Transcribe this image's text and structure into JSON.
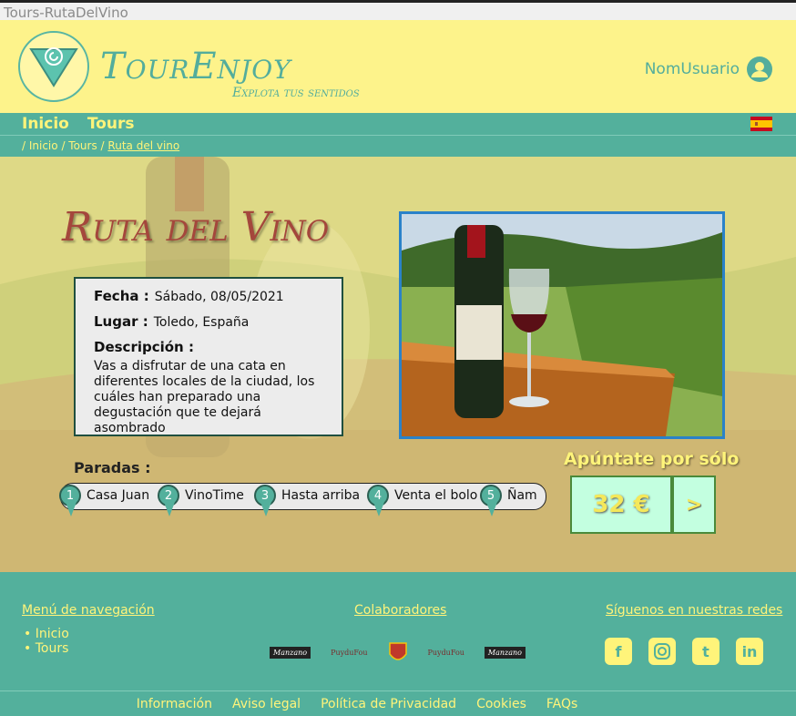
{
  "window": {
    "title": "Tours-RutaDelVino"
  },
  "header": {
    "brand": "TourEnjoy",
    "tagline": "Explota tus sentidos",
    "user_name": "NomUsuario"
  },
  "nav": {
    "items": [
      "Inicio",
      "Tours"
    ],
    "language_flag": "spain-flag-icon"
  },
  "breadcrumb": {
    "parts": [
      "/ Inicio",
      "/ Tours",
      "/"
    ],
    "current": "Ruta del vino"
  },
  "tour": {
    "title": "Ruta del Vino",
    "fecha_label": "Fecha :",
    "fecha": "Sábado, 08/05/2021",
    "lugar_label": "Lugar :",
    "lugar": "Toledo, España",
    "descripcion_label": "Descripción :",
    "descripcion": "Vas a disfrutar de una cata en diferentes locales de la ciudad, los cuáles han preparado una degustación que te dejará asombrado"
  },
  "paradas": {
    "label": "Paradas :",
    "stops": [
      {
        "num": "1",
        "name": "Casa Juan"
      },
      {
        "num": "2",
        "name": "VinoTime"
      },
      {
        "num": "3",
        "name": "Hasta arriba"
      },
      {
        "num": "4",
        "name": "Venta el bolo"
      },
      {
        "num": "5",
        "name": "Ñam"
      }
    ]
  },
  "cta": {
    "label": "Apúntate por sólo",
    "price": "32 €",
    "go": ">"
  },
  "footer": {
    "nav_title": "Menú de navegación",
    "nav_items": [
      "Inicio",
      "Tours"
    ],
    "collab_title": "Colaboradores",
    "partners": [
      "Manzano",
      "PuyduFou",
      "PuyduFou",
      "Manzano"
    ],
    "social_title": "Síguenos en nuestras redes",
    "socials": [
      "facebook-icon",
      "instagram-icon",
      "twitter-icon",
      "linkedin-icon"
    ],
    "bottom_links": [
      "Información",
      "Aviso legal",
      "Política de Privacidad",
      "Cookies",
      "FAQs"
    ]
  },
  "colors": {
    "teal": "#53b09c",
    "yellow": "#fdf38b",
    "link_yellow": "#fff47a",
    "title_red": "#a4473c"
  }
}
